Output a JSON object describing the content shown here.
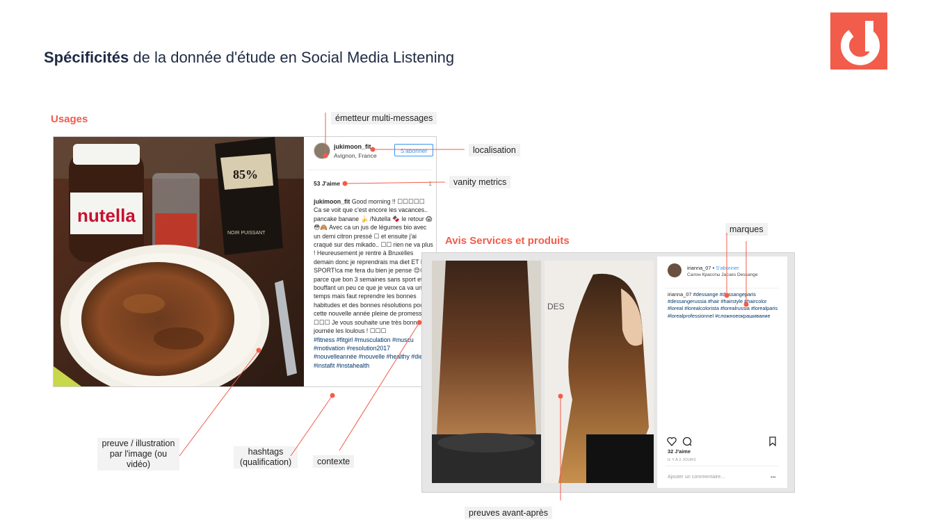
{
  "header": {
    "title_bold": "Spécificités",
    "title_rest": " de la donnée d'étude en Social Media Listening"
  },
  "sections": {
    "usages": "Usages",
    "avis": "Avis Services et produits"
  },
  "post1": {
    "username": "jukimoon_fit",
    "location": "Avignon, France",
    "follow": "S'abonner",
    "likes": "53 J'aime",
    "page": "1",
    "caption_user": "jukimoon_fit",
    "caption_text": " Good morning !! ☐☐☐☐☐ Ca se voit que c'est encore les vacances.. pancake banane 🍌 /Nutella 🍫 le retour 😱😳🙈 Avec ca un jus de légumes bio avec un demi citron pressé ☐ et ensuite j'ai craqué sur des mikado.. ☐☐ rien ne va plus ! Heureusement je rentre à Bruxelles demain donc je reprendrais ma diet ET LE SPORT!ca me fera du bien je pense 😌😋 parce que bon 3 semaines sans sport et en bouffant un peu ce que je veux ca va un temps mais faut reprendre les bonnes habitudes et des bonnes résolutions pour cette nouvelle année pleine de promesse ! ☐☐☐ Je vous souhaite une très bonne journée les loulous ! ☐☐☐",
    "hashtags": "#fitness #fitgirl #musculation #muscu #motivation #resolution2017 #nouvelleannée #nouvelle #healthy #diet #instafit #instahealth"
  },
  "post2": {
    "username": "irianna_07",
    "follow": "S'abonner",
    "subtitle": "Салон Красоты Jacues Dessange",
    "caption_user": "irianna_07",
    "caption_text": " #dessange #dessangeparis #dessangerussia #hair #hairstyle #haircolor #loreal #lorealcolorista #lorealrussia #lorealparis #lorealprofessionnel #сложноеокрашивание",
    "likes": "32 J'aime",
    "time": "IL Y A 2 JOURS",
    "comment_placeholder": "Ajouter un commentaire...",
    "more": "..."
  },
  "annotations": {
    "emetteur": "émetteur multi-messages",
    "localisation": "localisation",
    "vanity": "vanity metrics",
    "marques": "marques",
    "preuve": "preuve / illustration par l'image (ou vidéo)",
    "hashtags": "hashtags (qualification)",
    "contexte": "contexte",
    "avant_apres": "preuves avant-après"
  },
  "colors": {
    "accent": "#f25c4a",
    "title": "#1f2a44",
    "instagram_blue": "#3897f0"
  },
  "icons": [
    "logo-icon",
    "heart-icon",
    "comment-icon",
    "bookmark-icon",
    "more-icon"
  ]
}
